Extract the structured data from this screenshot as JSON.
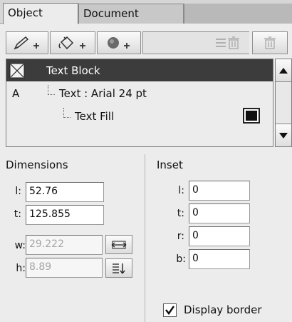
{
  "tabs": {
    "object": "Object",
    "document": "Document"
  },
  "toolbar": {
    "add_stroke": "pen-plus-icon",
    "add_fill": "fill-bucket-plus-icon",
    "add_effect": "circle-plus-icon",
    "delete_item": "list-trash-icon",
    "delete": "trash-icon"
  },
  "tree": {
    "items": [
      {
        "label": "Text Block",
        "icon": "text-block-icon"
      },
      {
        "prefix": "A",
        "label": "Text : Arial 24 pt"
      },
      {
        "label": "Text Fill",
        "swatch": "#111111"
      }
    ]
  },
  "dimensions": {
    "title": "Dimensions",
    "l_label": "l:",
    "l_value": "52.76",
    "t_label": "t:",
    "t_value": "125.855",
    "w_label": "w:",
    "w_value": "29.222",
    "h_label": "h:",
    "h_value": "8.89"
  },
  "inset": {
    "title": "Inset",
    "l_label": "l:",
    "l_value": "0",
    "t_label": "t:",
    "t_value": "0",
    "r_label": "r:",
    "r_value": "0",
    "b_label": "b:",
    "b_value": "0"
  },
  "display_border": {
    "label": "Display border",
    "checked": true
  }
}
